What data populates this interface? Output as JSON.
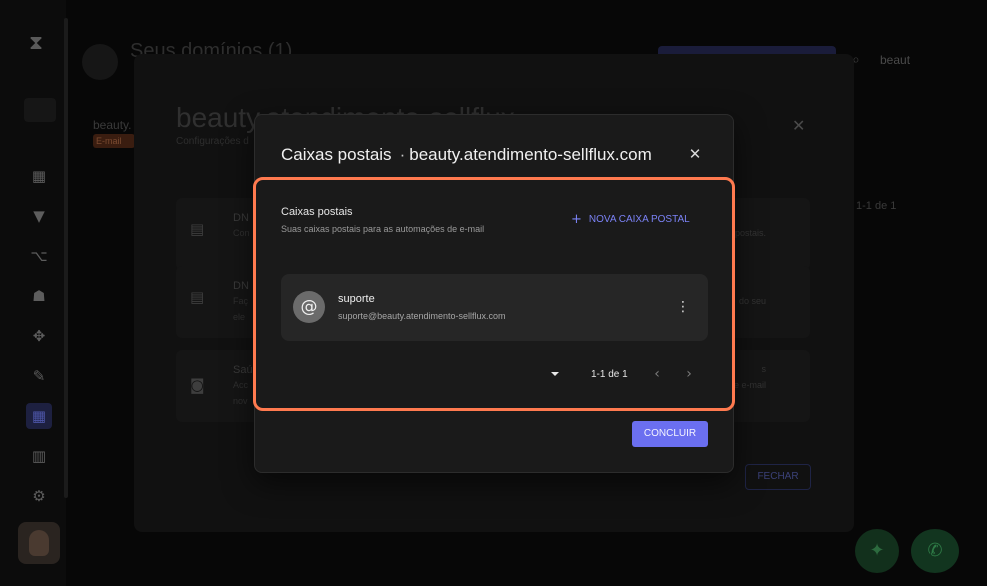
{
  "background": {
    "page_title": "Seus domínios (1)",
    "search_value": "beaut",
    "domain_item": "beauty.",
    "domain_badge": "E-mail",
    "domain_dialog": {
      "title": "beauty.atendimento-sellflux",
      "subtitle": "Configurações d",
      "cards": [
        {
          "title": "DN",
          "text": "Con",
          "right_text": "postais."
        },
        {
          "title": "DN",
          "text": "Faç",
          "text2": "ele",
          "right_text": "do seu"
        },
        {
          "title": "Saú",
          "text": "Acc",
          "text2": "nov",
          "right_text": "de e-mail",
          "right_title": "s"
        }
      ],
      "pagination": "1-1 de 1",
      "close_label": "FECHAR"
    }
  },
  "modal": {
    "title": "Caixas postais",
    "separator": "·",
    "domain": "beauty.atendimento-sellflux.com",
    "section_title": "Caixas postais",
    "section_subtitle": "Suas caixas postais para as automações de e-mail",
    "new_button_label": "NOVA CAIXA POSTAL",
    "mailboxes": [
      {
        "name": "suporte",
        "email": "suporte@beauty.atendimento-sellflux.com"
      }
    ],
    "pagination": "1-1 de 1",
    "confirm_label": "CONCLUIR"
  },
  "colors": {
    "highlight": "#ff7a4f",
    "accent": "#6b6ff0"
  }
}
